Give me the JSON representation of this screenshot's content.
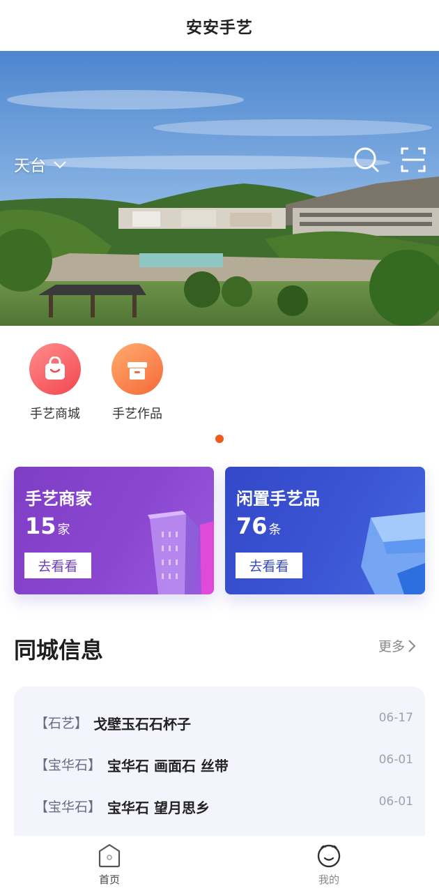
{
  "header": {
    "title": "安安手艺"
  },
  "banner": {
    "city": "天台"
  },
  "quick_entries": [
    {
      "label": "手艺商城",
      "icon": "shopping-bag-icon"
    },
    {
      "label": "手艺作品",
      "icon": "gift-box-icon"
    }
  ],
  "cards": [
    {
      "title": "手艺商家",
      "count": "15",
      "unit": "家",
      "action": "去看看"
    },
    {
      "title": "闲置手艺品",
      "count": "76",
      "unit": "条",
      "action": "去看看"
    }
  ],
  "section": {
    "title": "同城信息",
    "more": "更多"
  },
  "news": [
    {
      "tag": "【石艺】",
      "title": "戈壁玉石石杯子",
      "date": "06-17"
    },
    {
      "tag": "【宝华石】",
      "title": "宝华石 画面石 丝带",
      "date": "06-01"
    },
    {
      "tag": "【宝华石】",
      "title": "宝华石 望月思乡",
      "date": "06-01"
    }
  ],
  "tabbar": {
    "home": "首页",
    "mine": "我的"
  },
  "colors": {
    "accent": "#f05a1e",
    "card_purple": "#8a46cf",
    "card_blue": "#3b55d4"
  }
}
